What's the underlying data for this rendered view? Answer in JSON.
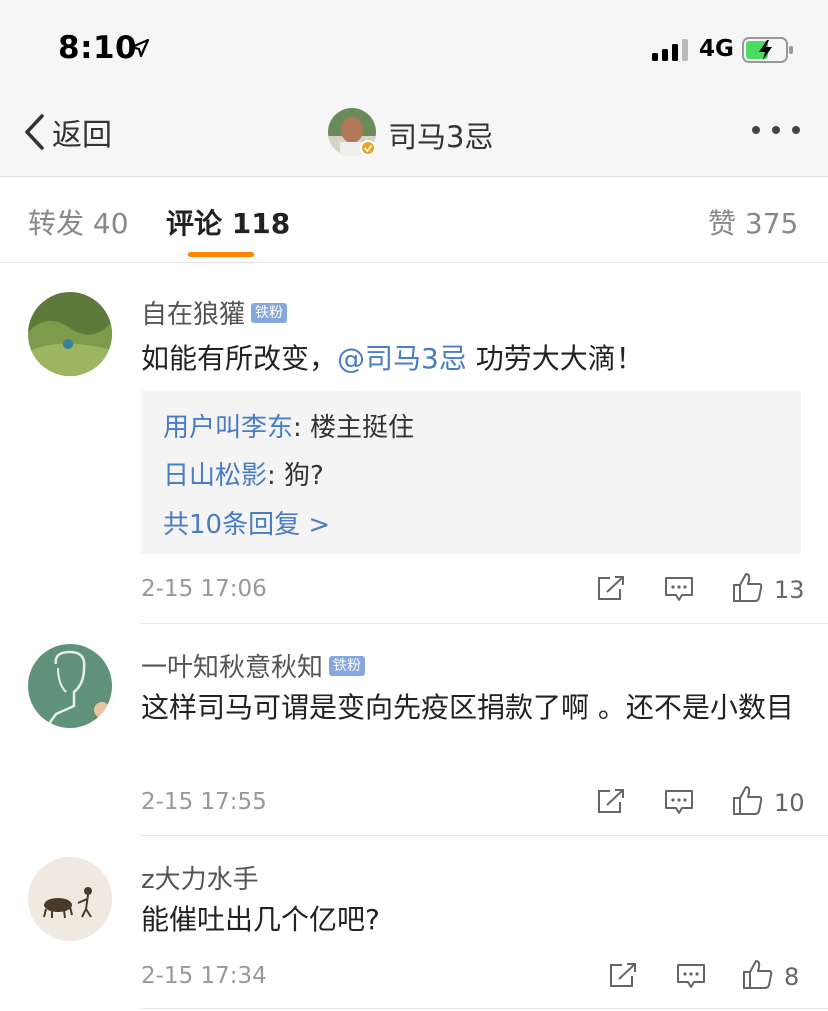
{
  "status_bar": {
    "time": "8:10",
    "network": "4G"
  },
  "nav": {
    "back_label": "返回",
    "title": "司马3忌"
  },
  "tabs": {
    "repost": "转发 40",
    "comments": "评论 118",
    "likes": "赞 375"
  },
  "comments": [
    {
      "user": "自在狼獾",
      "badge": "铁粉",
      "text_before": "如能有所改变，",
      "mention": "@司马3忌",
      "text_after": " 功劳大大滴！",
      "replies": [
        {
          "user": "用户叫李东",
          "sep": ": ",
          "text": "楼主挺住"
        },
        {
          "user": "日山松影",
          "sep": ": ",
          "text": "狗?"
        }
      ],
      "more_replies": "共10条回复 >",
      "date": "2-15 17:06",
      "likes": "13"
    },
    {
      "user": "一叶知秋意秋知",
      "badge": "铁粉",
      "text": "这样司马可谓是变向先疫区捐款了啊 。还不是小数目",
      "date": "2-15 17:55",
      "likes": "10"
    },
    {
      "user": "z大力水手",
      "text": "能催吐出几个亿吧?",
      "date": "2-15 17:34",
      "likes": "8"
    }
  ],
  "colors": {
    "accent": "#ff8200",
    "link": "#4a7cc4",
    "badge": "#86a8de"
  },
  "icons": [
    "location-arrow-icon",
    "signal-icon",
    "battery-charging-icon",
    "chevron-left-icon",
    "more-dots-icon",
    "verified-badge-icon",
    "repost-icon",
    "comment-icon",
    "thumbs-up-icon"
  ]
}
